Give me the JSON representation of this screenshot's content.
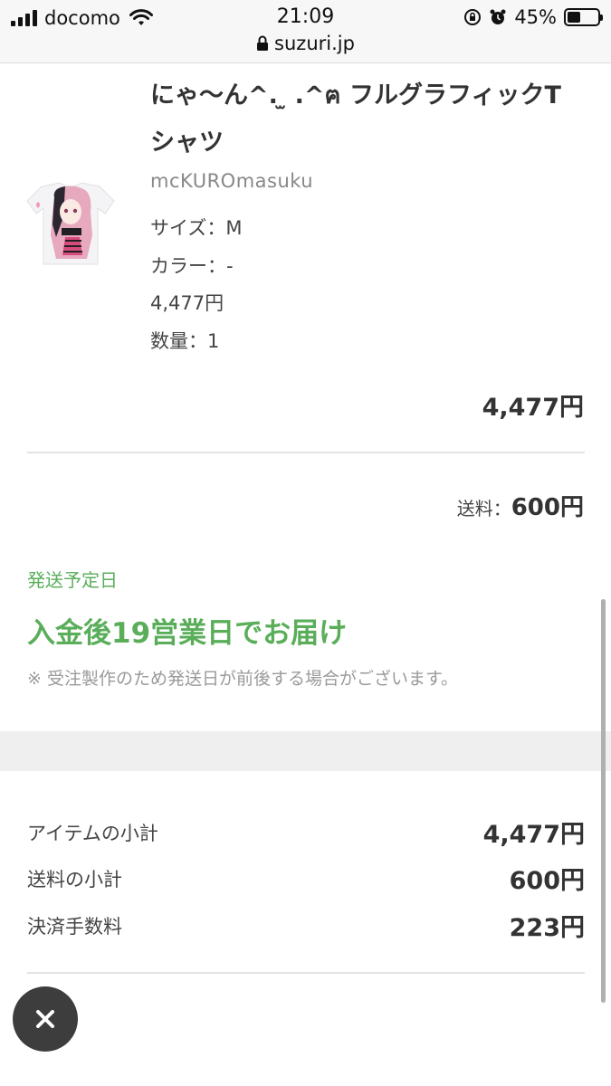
{
  "status_bar": {
    "carrier": "docomo",
    "time": "21:09",
    "battery": "45%",
    "battery_level": 0.45,
    "url": "suzuri.jp"
  },
  "product": {
    "title_line1": "にゃ〜ん^. ̫ .^ฅ フルグラフィックT",
    "title_line2": "シャツ",
    "shop": "mcKUROmasuku",
    "size": "サイズ：M",
    "color": "カラー：-",
    "unit_price": "4,477円",
    "quantity": "数量：1",
    "line_total": "4,477円"
  },
  "shipping": {
    "fee_label": "送料：",
    "fee_value": "600円",
    "date_label": "発送予定日",
    "date_value": "入金後19営業日でお届け",
    "note": "※ 受注製作のため発送日が前後する場合がございます。"
  },
  "summary": [
    {
      "label": "アイテムの小計",
      "value": "4,477円"
    },
    {
      "label": "送料の小計",
      "value": "600円"
    },
    {
      "label": "決済手数料",
      "value": "223円"
    }
  ],
  "colors": {
    "accent_green": "#5aae5a",
    "close_button": "#3d3d3d"
  },
  "icons": {
    "signal": "signal-icon",
    "wifi": "wifi-icon",
    "lock": "lock-icon",
    "orientation_lock": "orientation-lock-icon",
    "alarm": "alarm-icon",
    "battery": "battery-icon",
    "close": "close-icon"
  }
}
